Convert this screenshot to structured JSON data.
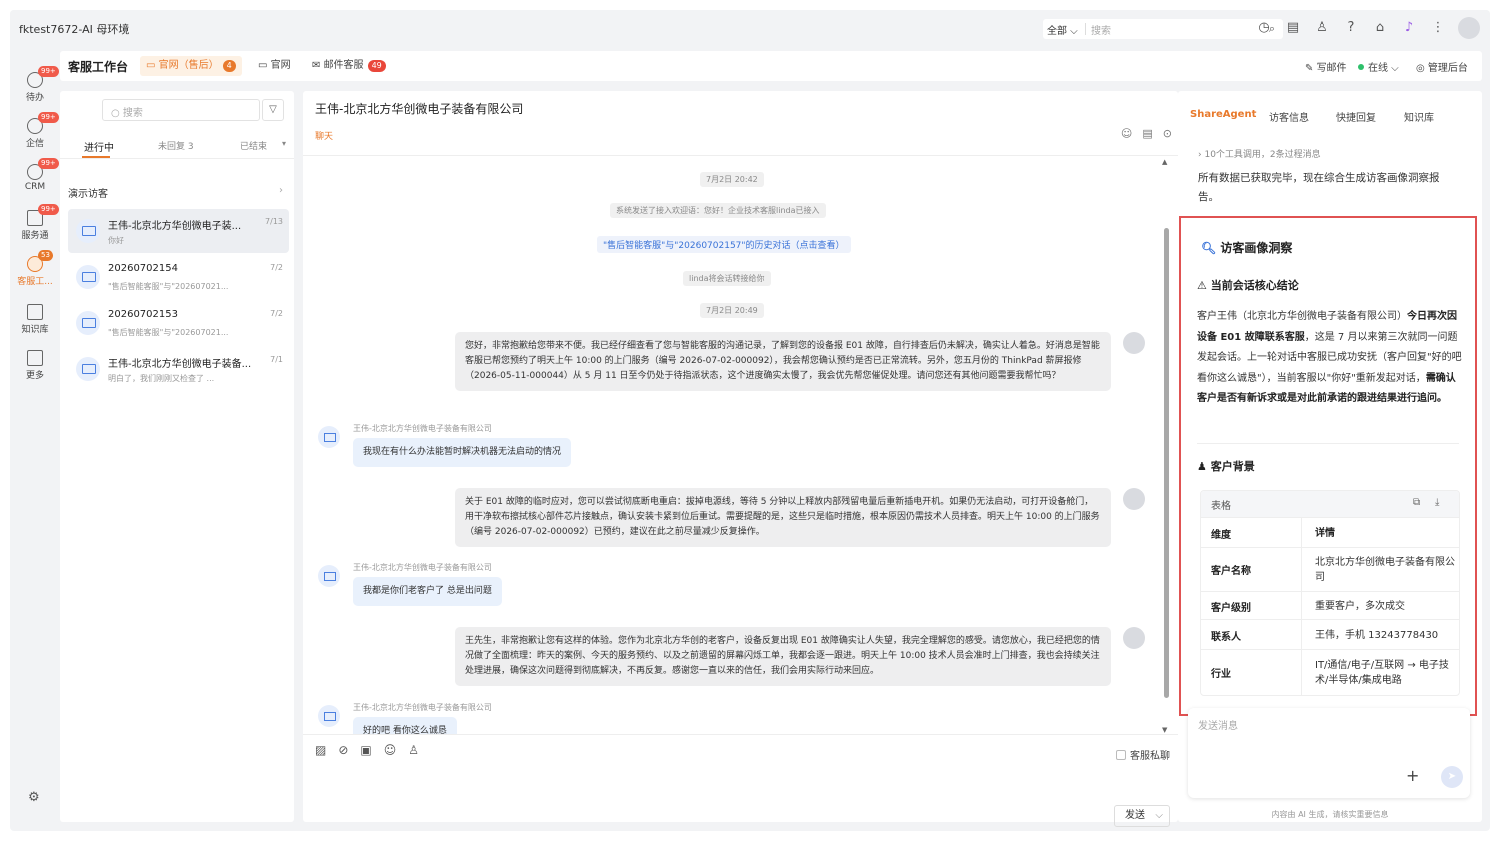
{
  "app": {
    "title": "fktest7672-AI 母环境"
  },
  "topbar": {
    "scope": "全部 ⌵",
    "search_placeholder": "搜索"
  },
  "nav": {
    "items": [
      {
        "label": "待办",
        "badge": "99+"
      },
      {
        "label": "企信",
        "badge": "99+"
      },
      {
        "label": "CRM",
        "badge": "99+"
      },
      {
        "label": "服务通",
        "badge": "99+"
      },
      {
        "label": "客服工...",
        "badge": "53"
      },
      {
        "label": "知识库"
      },
      {
        "label": "更多"
      }
    ]
  },
  "workspace": {
    "title": "客服工作台",
    "tabs": [
      {
        "label": "官网（售后）",
        "count": "4"
      },
      {
        "label": "官网"
      },
      {
        "label": "邮件客服",
        "count": "49"
      }
    ],
    "write_mail": "写邮件",
    "status": "在线 ⌵",
    "admin": "管理后台"
  },
  "list": {
    "search_placeholder": "搜索",
    "tabs": [
      "进行中",
      "未回复 3",
      "已结束"
    ],
    "group": "演示访客",
    "conversations": [
      {
        "name": "王伟-北京北方华创微电子装...",
        "preview": "你好",
        "date": "7/13"
      },
      {
        "name": "20260702154",
        "preview": "\"售后智能客服\"与\"202607021...",
        "date": "7/2"
      },
      {
        "name": "20260702153",
        "preview": "\"售后智能客服\"与\"202607021...",
        "date": "7/2"
      },
      {
        "name": "王伟-北京北方华创微电子装备...",
        "preview": "明白了，我们刚刚又检查了 ...",
        "date": "7/1"
      }
    ]
  },
  "chat": {
    "title": "王伟-北京北方华创微电子装备有限公司",
    "tag": "聊天",
    "sys": {
      "time1": "7月2日 20:42",
      "welcome": "系统发送了接入欢迎语：您好！企业技术客服linda已接入",
      "history": "\"售后智能客服\"与\"20260702157\"的历史对话（点击查看）",
      "transfer": "linda将会话转接给你",
      "time2": "7月2日 20:49"
    },
    "customer_name": "王伟-北京北方华创微电子装备有限公司",
    "messages": {
      "a1": "您好，非常抱歉给您带来不便。我已经仔细查看了您与智能客服的沟通记录，了解到您的设备报 E01 故障，自行排查后仍未解决，确实让人着急。好消息是智能客服已帮您预约了明天上午 10:00 的上门服务（编号 2026-07-02-000092），我会帮您确认预约是否已正常流转。另外，您五月份的 ThinkPad 薪屏报修（2026-05-11-000044）从 5 月 11 日至今仍处于待指派状态，这个进度确实太慢了，我会优先帮您催促处理。请问您还有其他问题需要我帮忙吗？",
      "c1": "我现在有什么办法能暂时解决机器无法启动的情况",
      "a2": "关于 E01 故障的临时应对，您可以尝试彻底断电重启：拔掉电源线，等待 5 分钟以上释放内部残留电量后重新插电开机。如果仍无法启动，可打开设备舱门，用干净软布擦拭核心部件芯片接触点，确认安装卡紧到位后重试。需要提醒的是，这些只是临时措施，根本原因仍需技术人员排查。明天上午 10:00 的上门服务（编号 2026-07-02-000092）已预约，建议在此之前尽量减少反复操作。",
      "c2": "我都是你们老客户了 总是出问题",
      "a3": "王先生，非常抱歉让您有这样的体验。您作为北京北方华创的老客户，设备反复出现 E01 故障确实让人失望，我完全理解您的感受。请您放心，我已经把您的情况做了全面梳理：昨天的案例、今天的服务预约、以及之前遗留的屏幕闪烁工单，我都会逐一跟进。明天上午 10:00 技术人员会准时上门排查，我也会持续关注处理进展，确保这次问题得到彻底解决，不再反复。感谢您一直以来的信任，我们会用实际行动来回应。",
      "c3": "好的吧 看你这么诚恳"
    },
    "private_label": "客服私聊",
    "send_label": "发送"
  },
  "side": {
    "tabs": [
      "ShareAgent",
      "访客信息",
      "快捷回复",
      "知识库"
    ],
    "tool_line": "10个工具调用，2条过程消息",
    "summary": "所有数据已获取完毕，现在综合生成访客画像洞察报告。",
    "card": {
      "title": "访客画像洞察",
      "sec1": "当前会话核心结论",
      "p1a": "客户王伟（北京北方华创微电子装备有限公司）",
      "p1b": "今日再次因设备 E01 故障联系客服",
      "p1c": "，这是 7 月以来第三次就同一问题发起会话。上一轮对话中客服已成功安抚（客户回复\"好的吧 看你这么诚恳\"），当前客服以\"你好\"重新发起对话，",
      "p1d": "需确认客户是否有新诉求或是对此前承诺的跟进结果进行追问。",
      "sec2": "客户背景",
      "table": {
        "title": "表格",
        "headers": [
          "维度",
          "详情"
        ],
        "rows": [
          [
            "客户名称",
            "北京北方华创微电子装备有限公司"
          ],
          [
            "客户级别",
            "重要客户，多次成交"
          ],
          [
            "联系人",
            "王伟，手机 13243778430"
          ],
          [
            "行业",
            "IT/通信/电子/互联网 → 电子技术/半导体/集成电路"
          ]
        ]
      }
    },
    "input_placeholder": "发送消息",
    "disclaimer": "内容由 AI 生成，请核实重要信息"
  }
}
